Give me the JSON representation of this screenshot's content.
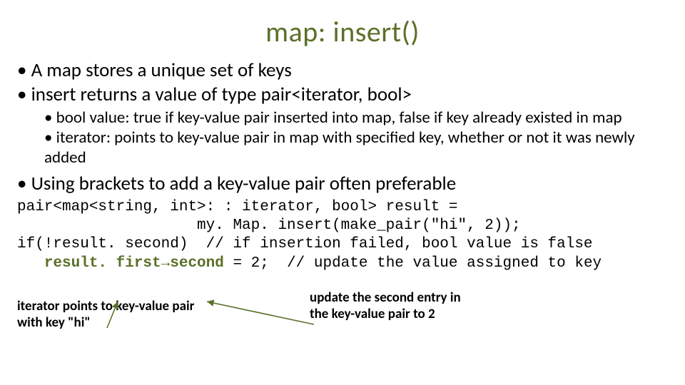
{
  "title": "map: insert()",
  "bullets": {
    "b1": "A map stores a unique set of keys",
    "b2": "insert returns a value of type pair<iterator, bool>",
    "b2_sub": {
      "s1": "bool value: true if key-value pair inserted into map, false if key already existed in map",
      "s2": "iterator: points to key-value pair in map with specified key, whether or not it was newly added"
    },
    "b3": "Using brackets to add a key-value pair often preferable"
  },
  "code": {
    "l1": "pair<map<string, int>: : iterator, bool> result =",
    "l2": "                    my. Map. insert(make_pair(\"hi\", 2));",
    "l3a": "if(!result. second)  // if insertion failed, bool value is false",
    "l4_pre": "   ",
    "l4_hl": "result. first→second",
    "l4_post": " = 2;  // update the value assigned to key"
  },
  "anno": {
    "left_l1": "iterator points to key-value pair",
    "left_l2": "with key \"hi\"",
    "right_l1": "update the second entry in",
    "right_l2": "the key-value pair to 2"
  },
  "chart_data": {
    "type": "table",
    "title": "map: insert()",
    "rows": [
      [
        "bullet",
        "A map stores a unique set of keys"
      ],
      [
        "bullet",
        "insert returns a value of type pair<iterator, bool>"
      ],
      [
        "sub-bullet",
        "bool value: true if key-value pair inserted into map, false if key already existed in map"
      ],
      [
        "sub-bullet",
        "iterator: points to key-value pair in map with specified key, whether or not it was newly added"
      ],
      [
        "bullet",
        "Using brackets to add a key-value pair often preferable"
      ],
      [
        "code",
        "pair<map<string, int>::iterator, bool> result = my.Map.insert(make_pair(\"hi\", 2));"
      ],
      [
        "code",
        "if(!result.second)  // if insertion failed, bool value is false"
      ],
      [
        "code",
        "   result.first->second = 2;  // update the value assigned to key"
      ],
      [
        "annotation",
        "iterator points to key-value pair with key \"hi\""
      ],
      [
        "annotation",
        "update the second entry in the key-value pair to 2"
      ]
    ]
  }
}
